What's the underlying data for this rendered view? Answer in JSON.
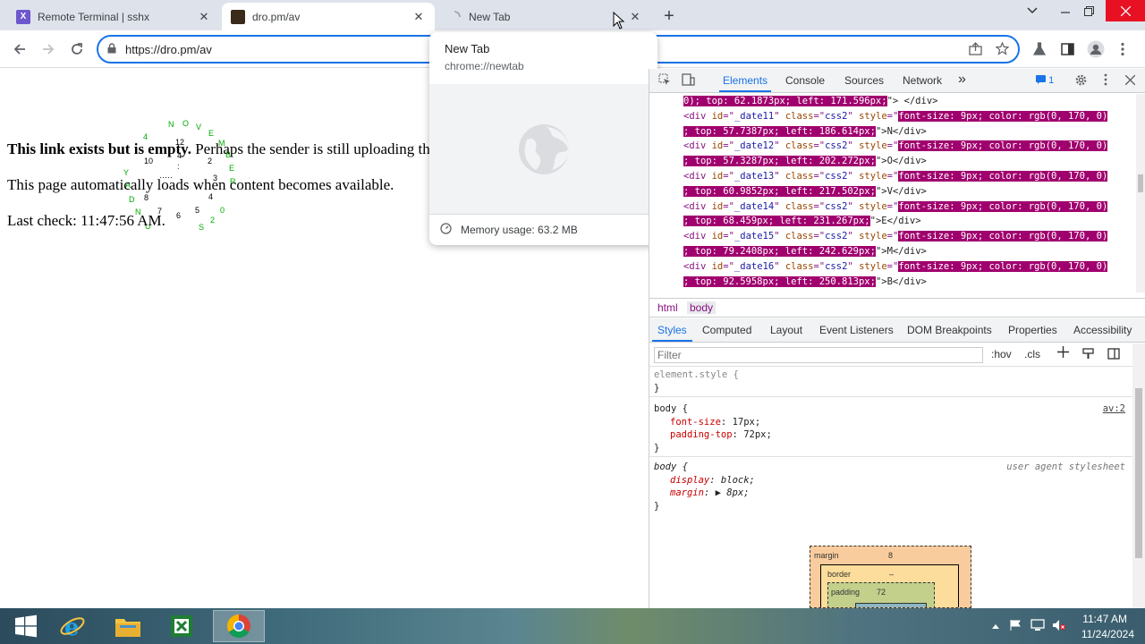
{
  "browser": {
    "tabs": [
      {
        "title": "Remote Terminal | sshx",
        "favicon": "sshx-icon",
        "favicon_color": "#6e56cf"
      },
      {
        "title": "dro.pm/av",
        "favicon": "dro-pm-icon",
        "favicon_color": "#3a2a1a"
      },
      {
        "title": "New Tab",
        "favicon": "loading-spinner-icon"
      }
    ],
    "new_tab_symbol": "+",
    "close_symbol": "✕",
    "url": "https://dro.pm/av"
  },
  "hovercard": {
    "title": "New Tab",
    "url": "chrome://newtab",
    "memory": "Memory usage: 63.2 MB"
  },
  "page": {
    "line1_bold": "This link exists but is empty.",
    "line1_rest": " Perhaps the sender is still uploading th",
    "line2": "This page automatically loads when content becomes available.",
    "line3": "Last check: 11:47:56 AM.",
    "clock_glyphs": [
      "N",
      "O",
      "V",
      "E",
      "M",
      "B",
      "E",
      "R",
      "4",
      "10",
      "12",
      "2",
      "3",
      "4",
      "5",
      "6",
      "7",
      "8",
      "Y",
      "A",
      "D",
      "N",
      "U",
      "S",
      "2",
      "0",
      "2",
      "4",
      ":",
      ":",
      "2"
    ]
  },
  "devtools": {
    "tabs": [
      "Elements",
      "Console",
      "Sources",
      "Network"
    ],
    "more_symbol": "»",
    "issues_count": "1",
    "dom_lines": [
      {
        "pre": "",
        "hl": "0); top: 62.1873px; left: 171.596px;",
        "post": "\"> </div>"
      },
      {
        "id": "_date11",
        "hl": "font-size: 9px; color: rgb(0, 170, 0)"
      },
      {
        "pre": "",
        "hl": "; top: 57.7387px; left: 186.614px;",
        "post": "\">N</div>"
      },
      {
        "id": "_date12",
        "hl": "font-size: 9px; color: rgb(0, 170, 0)"
      },
      {
        "pre": "",
        "hl": "; top: 57.3287px; left: 202.272px;",
        "post": "\">O</div>"
      },
      {
        "id": "_date13",
        "hl": "font-size: 9px; color: rgb(0, 170, 0)"
      },
      {
        "pre": "",
        "hl": "; top: 60.9852px; left: 217.502px;",
        "post": "\">V</div>"
      },
      {
        "id": "_date14",
        "hl": "font-size: 9px; color: rgb(0, 170, 0)"
      },
      {
        "pre": "",
        "hl": "; top: 68.459px; left: 231.267px;",
        "post": "\">E</div>"
      },
      {
        "id": "_date15",
        "hl": "font-size: 9px; color: rgb(0, 170, 0)"
      },
      {
        "pre": "",
        "hl": "; top: 79.2408px; left: 242.629px;",
        "post": "\">M</div>"
      },
      {
        "id": "_date16",
        "hl": "font-size: 9px; color: rgb(0, 170, 0)"
      },
      {
        "pre": "",
        "hl": "; top: 92.5958px; left: 250.813px;",
        "post": "\">B</div>"
      }
    ],
    "breadcrumbs": [
      "html",
      "body"
    ],
    "subtabs": [
      "Styles",
      "Computed",
      "Layout",
      "Event Listeners",
      "DOM Breakpoints",
      "Properties",
      "Accessibility"
    ],
    "filter_placeholder": "Filter",
    "hov": ":hov",
    "cls": ".cls",
    "styles": {
      "element_style": "element.style {",
      "close_brace": "}",
      "rule1_selector": "body {",
      "rule1_source": "av:2",
      "rule1_props": [
        {
          "name": "font-size",
          "value": "17px;"
        },
        {
          "name": "padding-top",
          "value": "72px;"
        }
      ],
      "rule2_selector": "body {",
      "rule2_source": "user agent stylesheet",
      "rule2_props": [
        {
          "name": "display",
          "value": "block;"
        },
        {
          "name": "margin",
          "value": "▶ 8px;"
        }
      ]
    },
    "boxmodel": {
      "margin_label": "margin",
      "margin_value": "8",
      "border_label": "border",
      "border_value": "–",
      "padding_label": "padding",
      "padding_value": "72"
    }
  },
  "taskbar": {
    "apps": [
      "start-icon",
      "internet-explorer-icon",
      "file-explorer-icon",
      "excel-icon",
      "chrome-icon"
    ],
    "time": "11:47 AM",
    "date": "11/24/2024"
  }
}
